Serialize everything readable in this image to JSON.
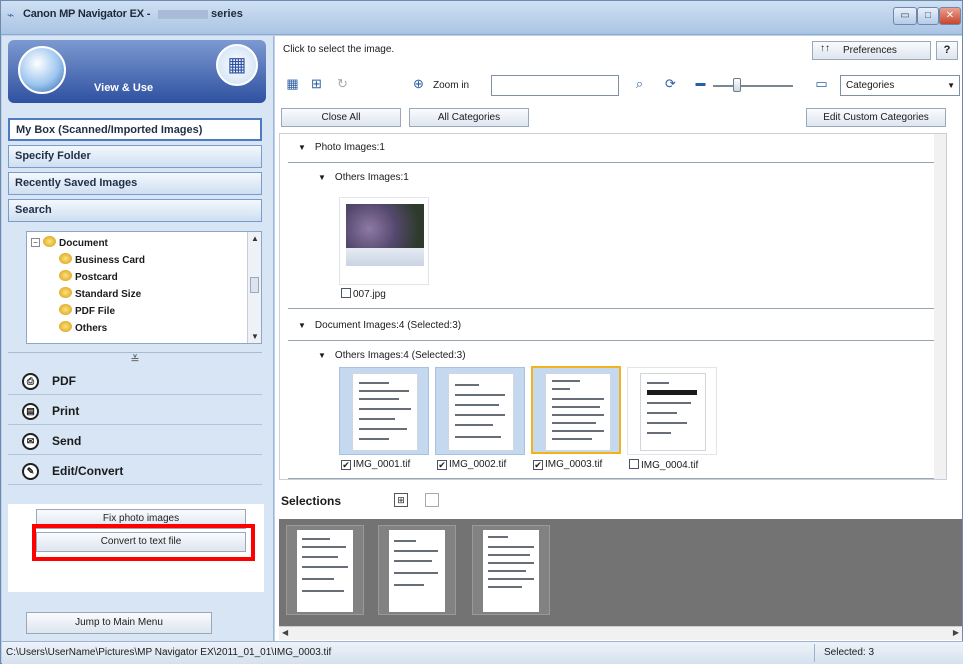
{
  "window": {
    "app_icon": "canon-logo-icon",
    "title": "Canon MP Navigator EX -",
    "title_suffix": "series",
    "controls": {
      "minimize": "▭",
      "maximize": "□",
      "close": "✕"
    }
  },
  "left": {
    "mode_title": "View & Use",
    "nav": {
      "mybox": "My Box (Scanned/Imported Images)",
      "folder": "Specify Folder",
      "recent": "Recently Saved Images",
      "search": "Search"
    },
    "tree": {
      "root": "Document",
      "children": [
        "Business Card",
        "Postcard",
        "Standard Size",
        "PDF File",
        "Others"
      ]
    },
    "expand_glyph": "≚",
    "actions": {
      "pdf": "PDF",
      "print": "Print",
      "send": "Send",
      "edit": "Edit/Convert"
    },
    "sub": {
      "fix": "Fix photo images",
      "convert": "Convert to text file"
    },
    "jump": "Jump to Main Menu"
  },
  "right": {
    "hint": "Click to select the image.",
    "preferences": "Preferences",
    "help": "?",
    "zoom_in": "Zoom in",
    "category_select": "Categories",
    "buttons": {
      "close_all": "Close All",
      "all_categories": "All Categories",
      "edit_custom": "Edit Custom Categories"
    },
    "groups": {
      "photo": "Photo   Images:1",
      "photo_others": "Others   Images:1",
      "document": "Document   Images:4   (Selected:3)",
      "document_others": "Others   Images:4   (Selected:3)"
    },
    "photo_file": "007.jpg",
    "doc_files": [
      {
        "name": "IMG_0001.tif",
        "checked": "✔"
      },
      {
        "name": "IMG_0002.tif",
        "checked": "✔"
      },
      {
        "name": "IMG_0003.tif",
        "checked": "✔"
      },
      {
        "name": "IMG_0004.tif",
        "checked": ""
      }
    ],
    "selections_label": "Selections"
  },
  "status": {
    "path": "C:\\Users\\UserName\\Pictures\\MP Navigator EX\\2011_01_01\\IMG_0003.tif",
    "selected": "Selected: 3"
  }
}
